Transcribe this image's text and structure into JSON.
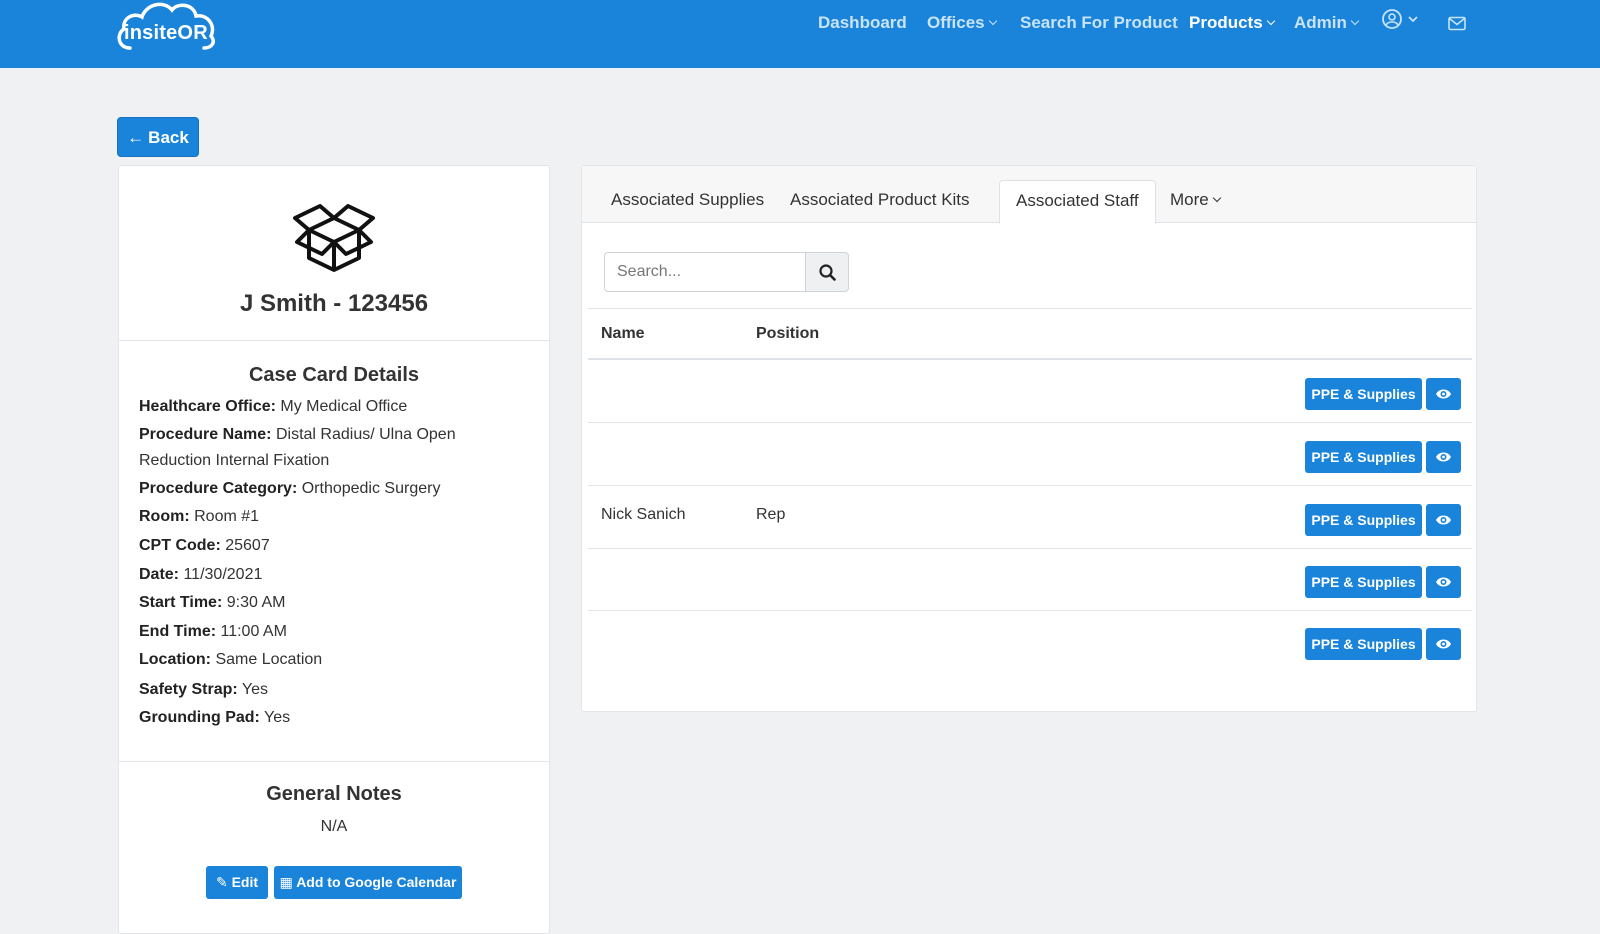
{
  "navbar": {
    "logo": "insiteOR",
    "links": {
      "dashboard": "Dashboard",
      "offices": "Offices",
      "search_product": "Search For Product",
      "products": "Products",
      "admin": "Admin"
    }
  },
  "back_label": "Back",
  "case": {
    "title": "J Smith - 123456",
    "details_title": "Case Card Details",
    "details": [
      {
        "label": "Healthcare Office:",
        "value": "My Medical Office"
      },
      {
        "label": "Procedure Name:",
        "value": "Distal Radius/ Ulna Open Reduction Internal Fixation"
      },
      {
        "label": "Procedure Category:",
        "value": "Orthopedic Surgery"
      },
      {
        "label": "Room:",
        "value": "Room #1"
      },
      {
        "label": "CPT Code:",
        "value": "25607"
      },
      {
        "label": "Date:",
        "value": "11/30/2021"
      },
      {
        "label": "Start Time:",
        "value": "9:30 AM"
      },
      {
        "label": "End Time:",
        "value": "11:00 AM"
      },
      {
        "label": "Location:",
        "value": "Same Location"
      },
      {
        "label": "Safety Strap:",
        "value": "Yes"
      },
      {
        "label": "Grounding Pad:",
        "value": "Yes"
      }
    ],
    "notes_title": "General Notes",
    "notes_value": "N/A",
    "edit_label": "Edit",
    "calendar_label": "Add to Google Calendar"
  },
  "tabs": {
    "supplies": "Associated Supplies",
    "kits": "Associated Product Kits",
    "staff": "Associated Staff",
    "more": "More"
  },
  "search": {
    "placeholder": "Search..."
  },
  "table": {
    "headers": {
      "name": "Name",
      "position": "Position"
    },
    "button_label": "PPE & Supplies",
    "rows": [
      {
        "name": "",
        "position": ""
      },
      {
        "name": "",
        "position": ""
      },
      {
        "name": "Nick Sanich",
        "position": "Rep"
      },
      {
        "name": "",
        "position": ""
      },
      {
        "name": "",
        "position": ""
      }
    ]
  },
  "colors": {
    "primary": "#1a84da",
    "background": "#f0f1f3"
  }
}
